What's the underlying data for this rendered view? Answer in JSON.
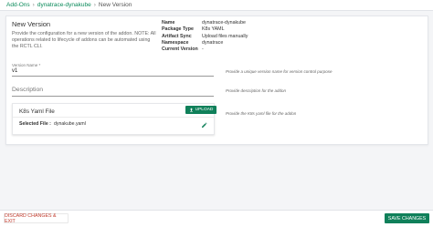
{
  "breadcrumb": {
    "root": "Add-Ons",
    "addon": "dynatrace-dynakube",
    "current": "New Version"
  },
  "card": {
    "title": "New Version",
    "description": "Provide the configuration for a new version of the addon. NOTE: All operations related to lifecycle of addons can be automated using the RCTL CLI."
  },
  "meta": [
    {
      "label": "Name",
      "value": "dynatrace-dynakube"
    },
    {
      "label": "Package Type",
      "value": "K8s YAML"
    },
    {
      "label": "Artifact Sync",
      "value": "Upload files manually"
    },
    {
      "label": "Namespace",
      "value": "dynatrace"
    },
    {
      "label": "Current Version",
      "value": "-"
    }
  ],
  "form": {
    "version_label": "Version Name *",
    "version_value": "v1",
    "version_helper": "Provide a unique version name for version control purpose",
    "description_placeholder": "Description",
    "description_helper": "Provide description for the addon",
    "k8s_helper": "Provide the K8s yaml file for the addon"
  },
  "k8s": {
    "title": "K8s Yaml File",
    "upload_label": "Upload",
    "selected_label": "Selected File :",
    "selected_value": "dynakube.yaml"
  },
  "footer": {
    "discard_label": "Discard Changes & Exit",
    "save_label": "Save Changes"
  },
  "colors": {
    "accent": "#10805a",
    "danger": "#c0392b"
  },
  "icons": {
    "upload": "upload-icon",
    "edit": "pencil-icon"
  }
}
